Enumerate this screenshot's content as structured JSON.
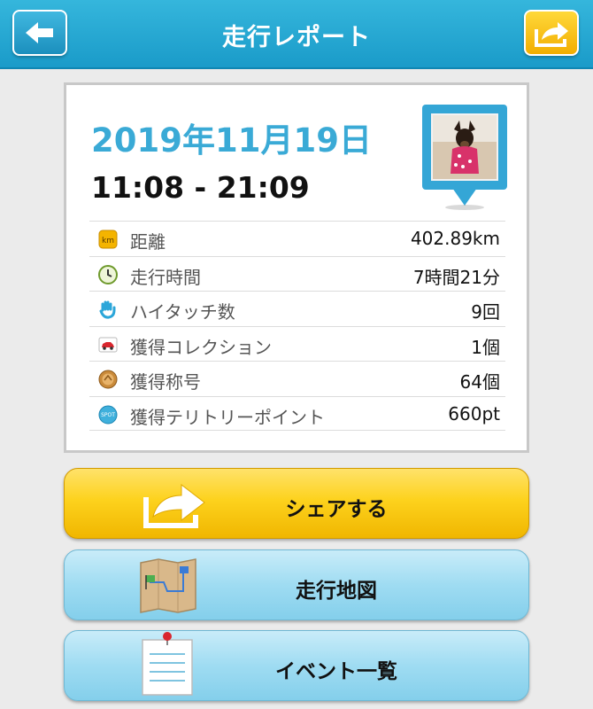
{
  "header": {
    "title": "走行レポート"
  },
  "report": {
    "date": "2019年11月19日",
    "time_range": "11:08 - 21:09"
  },
  "stats": [
    {
      "icon": "km-icon",
      "label": "距離",
      "value": "402.89km"
    },
    {
      "icon": "clock-icon",
      "label": "走行時間",
      "value": "7時間21分"
    },
    {
      "icon": "hi-touch-hand-icon",
      "label": "ハイタッチ数",
      "value": "9回"
    },
    {
      "icon": "car-collection-icon",
      "label": "獲得コレクション",
      "value": "1個"
    },
    {
      "icon": "title-medal-icon",
      "label": "獲得称号",
      "value": "64個"
    },
    {
      "icon": "spot-icon",
      "label": "獲得テリトリーポイント",
      "value": "660pt"
    }
  ],
  "actions": {
    "share_label": "シェアする",
    "map_label": "走行地図",
    "events_label": "イベント一覧"
  },
  "colors": {
    "header": "#1fa3d1",
    "date": "#3aaad6",
    "share_button": "#fdd21d",
    "secondary_button": "#9fdcf2"
  }
}
